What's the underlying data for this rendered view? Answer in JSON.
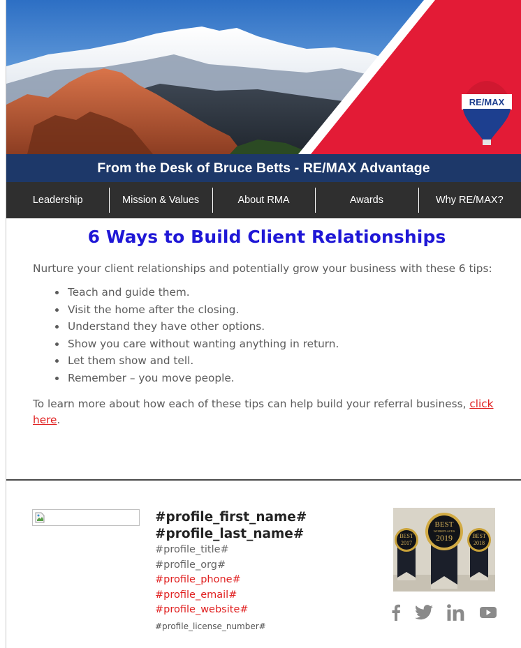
{
  "header": {
    "logo_text": "RE/MAX",
    "desk_title": "From the Desk of Bruce Betts - RE/MAX Advantage",
    "colors": {
      "brand_blue": "#1d3869",
      "brand_red": "#e31b36",
      "nav_bg": "#2f2f2f"
    }
  },
  "nav": {
    "items": [
      {
        "label": "Leadership"
      },
      {
        "label": "Mission & Values"
      },
      {
        "label": "About RMA"
      },
      {
        "label": "Awards"
      },
      {
        "label": "Why RE/MAX?"
      }
    ]
  },
  "article": {
    "headline": "6 Ways to Build Client Relationships",
    "intro": "Nurture your client relationships and potentially grow your business with these 6 tips:",
    "tips": [
      "Teach and guide them.",
      "Visit the home after the closing.",
      "Understand they have other options.",
      "Show you care without wanting anything in return.",
      "Let them show and tell.",
      "Remember – you move people."
    ],
    "outro_text": "To learn more about how each of these tips can help build your referral business, ",
    "outro_link": "click here",
    "outro_end": ".",
    "headline_color": "#1f17d6",
    "link_color": "#e02020"
  },
  "signature": {
    "first_name": "#profile_first_name#",
    "last_name": "#profile_last_name#",
    "title": "#profile_title#",
    "org": "#profile_org#",
    "phone": "#profile_phone#",
    "email": "#profile_email#",
    "website": "#profile_website#",
    "license": "#profile_license_number#",
    "awards": {
      "badge_left": {
        "line1": "BEST",
        "year": "2017"
      },
      "badge_center": {
        "line1": "BEST",
        "line2": "WORKPLACES",
        "year": "2019"
      },
      "badge_right": {
        "line1": "BEST",
        "year": "2018"
      }
    },
    "social_icons": [
      "facebook-icon",
      "twitter-icon",
      "linkedin-icon",
      "youtube-icon"
    ]
  }
}
